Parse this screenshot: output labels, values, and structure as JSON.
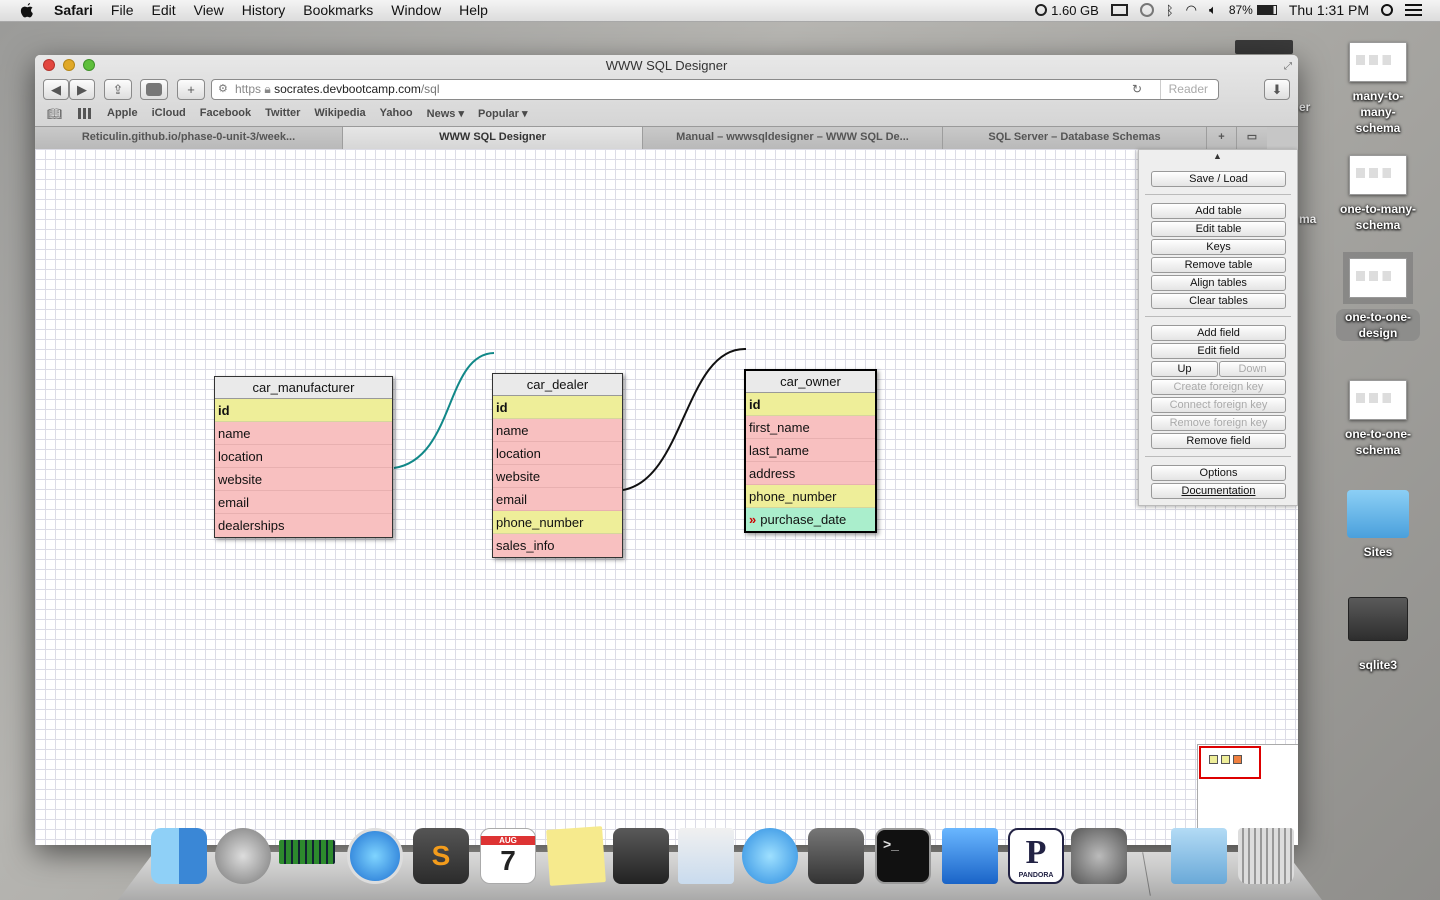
{
  "menubar": {
    "app": "Safari",
    "items": [
      "File",
      "Edit",
      "View",
      "History",
      "Bookmarks",
      "Window",
      "Help"
    ],
    "memory": "1.60 GB",
    "battery": "87%",
    "clock": "Thu 1:31 PM"
  },
  "window": {
    "title": "WWW SQL Designer",
    "url_scheme": "https",
    "url_host": "socrates.devbootcamp.com",
    "url_path": "/sql",
    "reader": "Reader",
    "bookmarks": [
      "Apple",
      "iCloud",
      "Facebook",
      "Twitter",
      "Wikipedia",
      "Yahoo",
      "News ▾",
      "Popular ▾"
    ],
    "tabs": [
      "Reticulin.github.io/phase-0-unit-3/week...",
      "WWW SQL Designer",
      "Manual – wwwsqldesigner – WWW SQL De...",
      "SQL Server – Database Schemas"
    ]
  },
  "tables": [
    {
      "name": "car_manufacturer",
      "fields": [
        "id",
        "name",
        "location",
        "website",
        "email",
        "dealerships"
      ]
    },
    {
      "name": "car_dealer",
      "fields": [
        "id",
        "name",
        "location",
        "website",
        "email",
        "phone_number",
        "sales_info"
      ]
    },
    {
      "name": "car_owner",
      "fields": [
        "id",
        "first_name",
        "last_name",
        "address",
        "phone_number",
        "purchase_date"
      ]
    }
  ],
  "panel": {
    "save_load": "Save / Load",
    "add_table": "Add table",
    "edit_table": "Edit table",
    "keys": "Keys",
    "remove_table": "Remove table",
    "align_tables": "Align tables",
    "clear_tables": "Clear tables",
    "add_field": "Add field",
    "edit_field": "Edit field",
    "up": "Up",
    "down": "Down",
    "create_fk": "Create foreign key",
    "connect_fk": "Connect foreign key",
    "remove_fk": "Remove foreign key",
    "remove_field": "Remove field",
    "options": "Options",
    "documentation": "Documentation"
  },
  "desktop": {
    "icons": [
      "many-to-many-schema",
      "one-to-many-schema",
      "one-to-one-design",
      "one-to-one-schema",
      "Sites",
      "sqlite3"
    ],
    "partial_labels": [
      "er",
      "ma"
    ]
  },
  "dock": {
    "sublime_letter": "S",
    "calendar_month": "AUG",
    "calendar_day": "7",
    "pandora_letter": "P",
    "pandora_label": "PANDORA"
  }
}
